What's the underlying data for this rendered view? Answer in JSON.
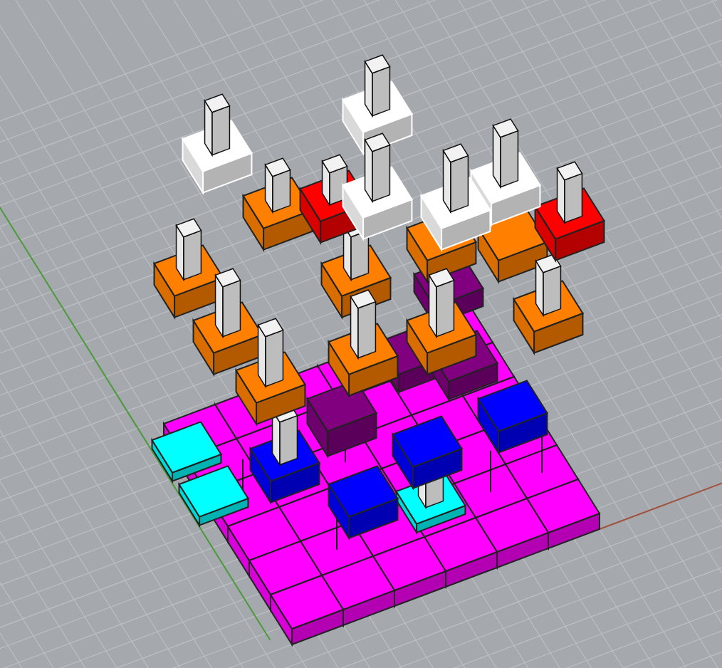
{
  "viewport": {
    "layers": [
      {
        "kind": "base",
        "color": "#ff00ff"
      },
      {
        "kind": "tile",
        "color": "#00ffff"
      },
      {
        "kind": "tile",
        "color": "#0000ff"
      },
      {
        "kind": "tile",
        "color": "#800080"
      },
      {
        "kind": "tile",
        "color": "#ff8000"
      },
      {
        "kind": "tile",
        "color": "#ff0000"
      },
      {
        "kind": "tile",
        "color": "#ffffff"
      }
    ]
  }
}
